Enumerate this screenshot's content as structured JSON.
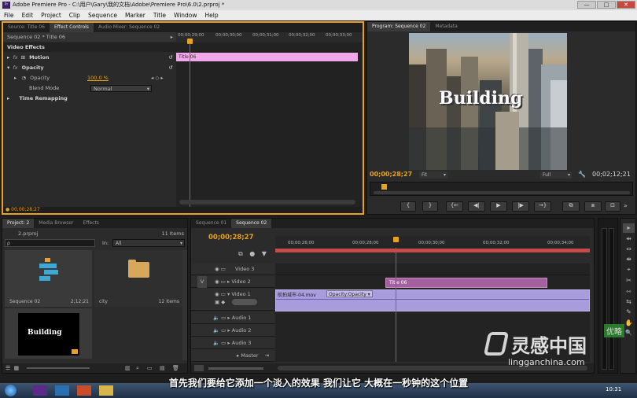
{
  "window": {
    "title": "Adobe Premiere Pro - C:\\用户\\Gary\\我的文档\\Adobe\\Premiere Pro\\6.0\\2.prproj *",
    "buttons": [
      "—",
      "□",
      "✕"
    ]
  },
  "menu": [
    "File",
    "Edit",
    "Project",
    "Clip",
    "Sequence",
    "Marker",
    "Title",
    "Window",
    "Help"
  ],
  "source_panel": {
    "tabs": [
      "Source: Title 06",
      "Effect Controls",
      "Audio Mixer: Sequence 02"
    ],
    "active_tab": "Effect Controls",
    "clip_path": "Sequence 02 * Title 06",
    "timecodes": [
      "00;00;29;00",
      "00;00;30;00",
      "00;00;31;00",
      "00;00;32;00",
      "00;00;33;00"
    ],
    "clip_bar_label": "Title 06",
    "section_label": "Video Effects",
    "effects": [
      {
        "label": "Motion"
      },
      {
        "label": "Opacity"
      },
      {
        "label": "Time Remapping"
      }
    ],
    "opacity_label": "Opacity",
    "opacity_value": "100.0 %",
    "blend_mode_label": "Blend Mode",
    "blend_mode_value": "Normal",
    "current_time": "00;00;28;27"
  },
  "program_panel": {
    "tabs": [
      "Program: Sequence 02",
      "Metadata"
    ],
    "active_tab": "Program: Sequence 02",
    "overlay_title": "Building",
    "current_time": "00;00;28;27",
    "fit_value": "Fit",
    "quality_value": "Full",
    "duration": "00;02;12;21",
    "transport": [
      "{",
      "}",
      "{←",
      "◀|",
      "▶",
      "|▶",
      "→}",
      "⧉",
      "⧈"
    ]
  },
  "project_panel": {
    "tabs": [
      "Project: 2",
      "Media Browser",
      "Effects"
    ],
    "active_tab": "Project: 2",
    "project_file": "2.prproj",
    "item_count": "11 Items",
    "search_placeholder": "ρ",
    "in_label": "In:",
    "in_value": "All",
    "items": [
      {
        "name": "Sequence 02",
        "meta": "2;12;21"
      },
      {
        "name": "city",
        "meta": "12 Items"
      },
      {
        "name": "",
        "meta": ""
      }
    ],
    "thumb_title": "Building"
  },
  "timeline_panel": {
    "tabs": [
      "Sequence 01",
      "Sequence 02"
    ],
    "active_tab": "Sequence 02",
    "current_time": "00;00;28;27",
    "timecodes": [
      "00;00;26;00",
      "00;00;28;00",
      "00;00;30;00",
      "00;00;32;00",
      "00;00;34;00"
    ],
    "tracks": [
      {
        "name": "Video 3",
        "kind": "video"
      },
      {
        "name": "Video 2",
        "kind": "video"
      },
      {
        "name": "Video 1",
        "kind": "video"
      },
      {
        "name": "Audio 1",
        "kind": "audio"
      },
      {
        "name": "Audio 2",
        "kind": "audio"
      },
      {
        "name": "Audio 3",
        "kind": "audio"
      },
      {
        "name": "Master",
        "kind": "master"
      }
    ],
    "v_label": "V",
    "title_clip": "Title 06",
    "video_clip": "航拍城市-04.mov",
    "video_clip_effect": "Opacity:Opacity"
  },
  "tools": [
    "▸",
    "⇹",
    "⇔",
    "⇼",
    "⌖",
    "✂",
    "⇿",
    "⇆",
    "✎",
    "✋",
    "🔍"
  ],
  "audio_meter_labels": [
    "0",
    "-6",
    "-12",
    "-18",
    "-24",
    "-30",
    "-36",
    "-42",
    "-48",
    "-54"
  ],
  "subtitle": "首先我们要给它添加一个淡入的效果  我们让它  大概在一秒钟的这个位置",
  "watermark": {
    "brand": "灵感中国",
    "url": "lingganchina.com",
    "badge": "优略"
  },
  "taskbar": {
    "clock": "10:31"
  },
  "colors": {
    "accent_orange": "#e8a21f",
    "clip_pink": "#f2a8e8",
    "title_clip": "#a560a0",
    "video_clip": "#a99cdc",
    "playhead": "#e23b3b"
  }
}
